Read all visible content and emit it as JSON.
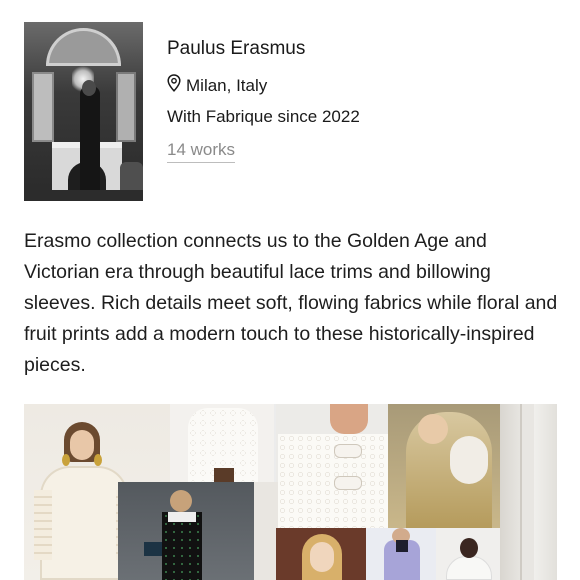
{
  "artist": {
    "name": "Paulus Erasmus",
    "location": "Milan, Italy",
    "since": "With Fabrique since 2022",
    "works": "14 works"
  },
  "description": "Erasmo collection connects us to the Golden Age and Victorian era through beautiful lace trims and billowing sleeves. Rich details meet soft, flowing fabrics while floral and fruit prints add a modern touch to these historically-inspired pieces.",
  "icons": {
    "location": "map-pin-icon"
  }
}
